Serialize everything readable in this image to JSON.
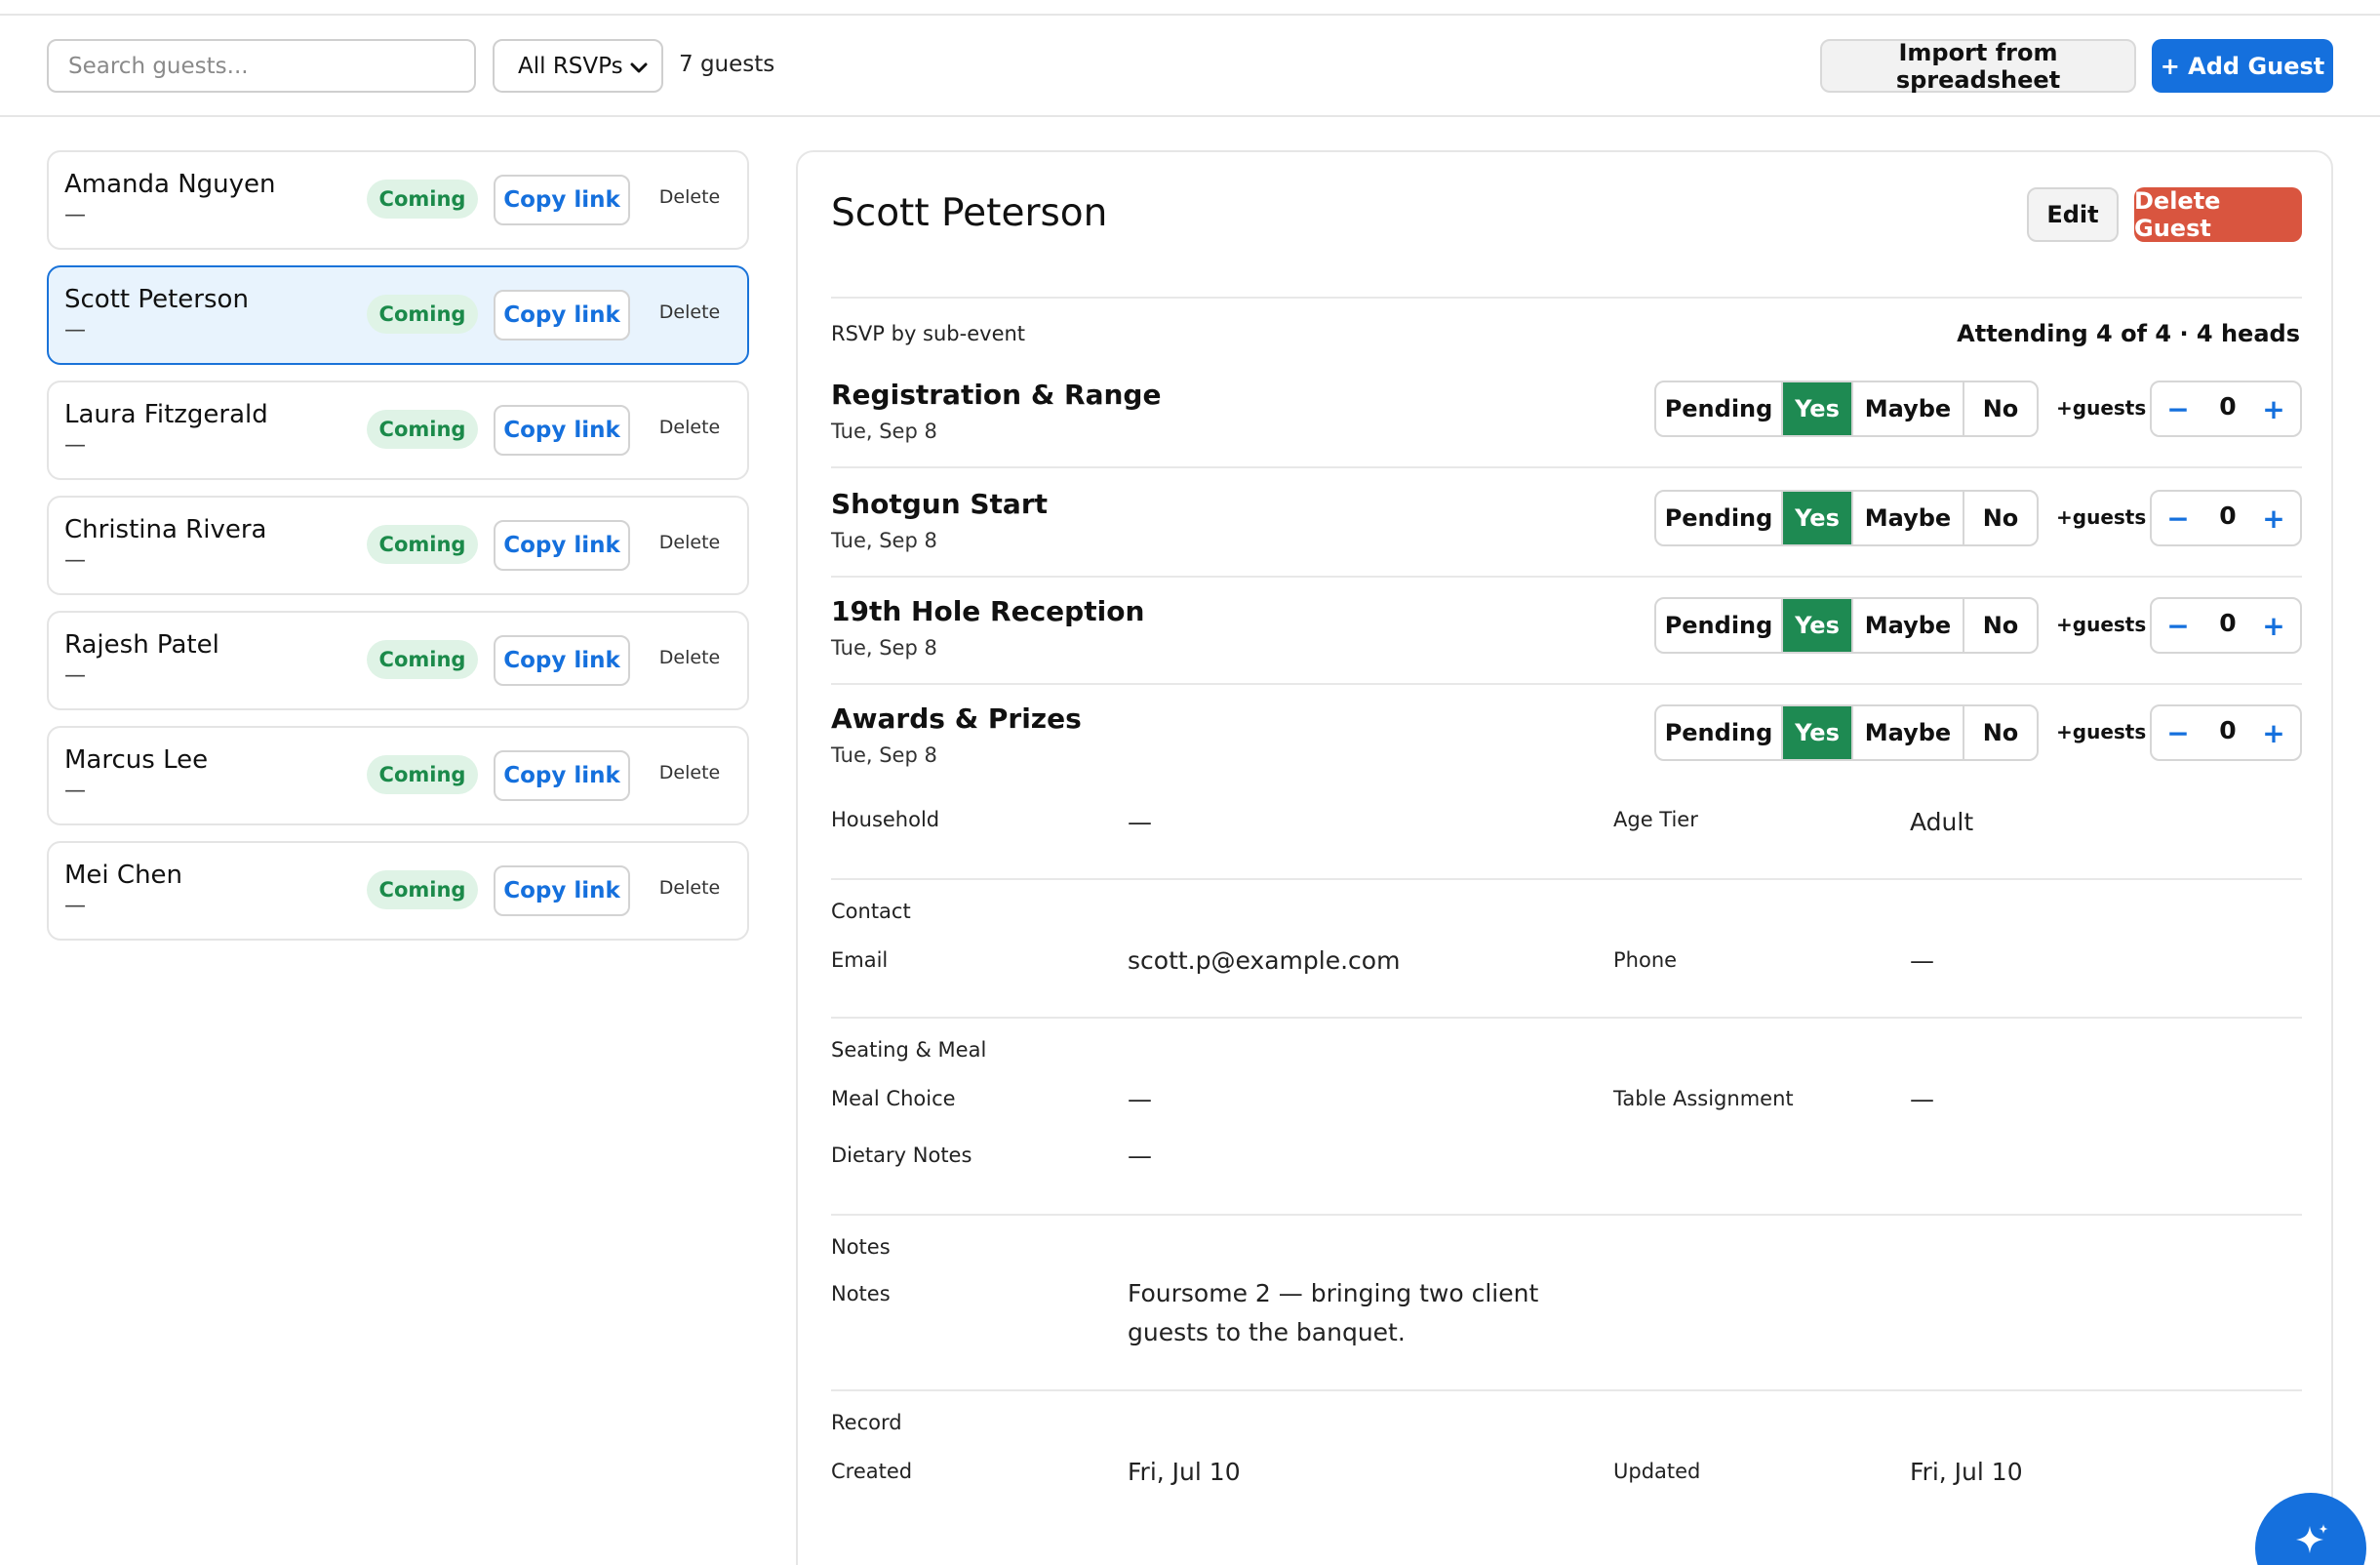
{
  "toolbar": {
    "search_placeholder": "Search guests...",
    "rsvp_filter": "All RSVPs",
    "guest_count": "7 guests",
    "import_label": "Import from spreadsheet",
    "add_label": "+ Add Guest"
  },
  "guests": [
    {
      "name": "Amanda Nguyen",
      "sub": "—",
      "status": "Coming",
      "copy": "Copy link",
      "delete": "Delete"
    },
    {
      "name": "Scott Peterson",
      "sub": "—",
      "status": "Coming",
      "copy": "Copy link",
      "delete": "Delete"
    },
    {
      "name": "Laura Fitzgerald",
      "sub": "—",
      "status": "Coming",
      "copy": "Copy link",
      "delete": "Delete"
    },
    {
      "name": "Christina Rivera",
      "sub": "—",
      "status": "Coming",
      "copy": "Copy link",
      "delete": "Delete"
    },
    {
      "name": "Rajesh Patel",
      "sub": "—",
      "status": "Coming",
      "copy": "Copy link",
      "delete": "Delete"
    },
    {
      "name": "Marcus Lee",
      "sub": "—",
      "status": "Coming",
      "copy": "Copy link",
      "delete": "Delete"
    },
    {
      "name": "Mei Chen",
      "sub": "—",
      "status": "Coming",
      "copy": "Copy link",
      "delete": "Delete"
    }
  ],
  "selected_guest": "Scott Peterson",
  "detail": {
    "title": "Scott Peterson",
    "edit_label": "Edit",
    "delete_label": "Delete Guest",
    "rsvp_section": "RSVP by sub-event",
    "attending": "Attending 4 of 4 · 4 heads",
    "rsvp_options": {
      "pending": "Pending",
      "yes": "Yes",
      "maybe": "Maybe",
      "no": "No"
    },
    "plus_guests_label": "+guests",
    "events": [
      {
        "name": "Registration & Range",
        "date": "Tue, Sep 8",
        "selected": "Yes",
        "extra": "0"
      },
      {
        "name": "Shotgun Start",
        "date": "Tue, Sep 8",
        "selected": "Yes",
        "extra": "0"
      },
      {
        "name": "19th Hole Reception",
        "date": "Tue, Sep 8",
        "selected": "Yes",
        "extra": "0"
      },
      {
        "name": "Awards & Prizes",
        "date": "Tue, Sep 8",
        "selected": "Yes",
        "extra": "0"
      }
    ],
    "household_label": "Household",
    "household_value": "—",
    "age_tier_label": "Age Tier",
    "age_tier_value": "Adult",
    "contact_section": "Contact",
    "email_label": "Email",
    "email_value": "scott.p@example.com",
    "phone_label": "Phone",
    "phone_value": "—",
    "seating_section": "Seating & Meal",
    "meal_label": "Meal Choice",
    "meal_value": "—",
    "table_label": "Table Assignment",
    "table_value": "—",
    "dietary_label": "Dietary Notes",
    "dietary_value": "—",
    "notes_section": "Notes",
    "notes_label": "Notes",
    "notes_value": "Foursome 2 — bringing two client guests to the banquet.",
    "record_section": "Record",
    "created_label": "Created",
    "created_value": "Fri, Jul 10",
    "updated_label": "Updated",
    "updated_value": "Fri, Jul 10"
  },
  "colors": {
    "accent": "#1570dd",
    "coming_badge_bg": "#dff3e6",
    "coming_badge_text": "#1b8a4a",
    "yes_selected": "#1e8a52",
    "danger": "#d9553f",
    "selected_row_bg": "#e8f3fd"
  },
  "icons": {
    "select_chevron": "chevron-down-icon",
    "fab": "sparkle-icon"
  }
}
